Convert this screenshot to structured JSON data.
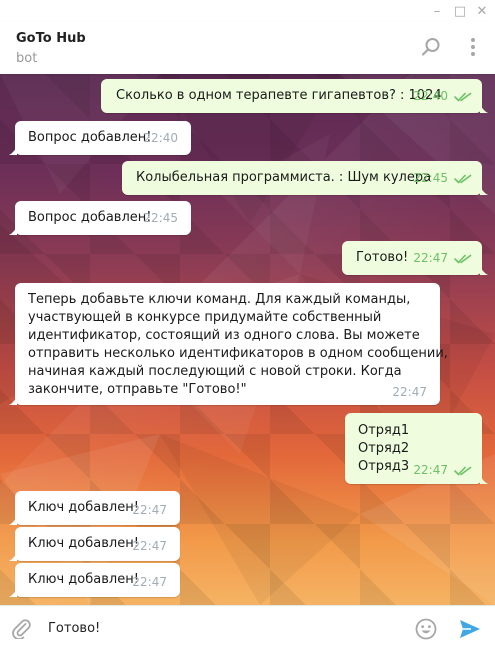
{
  "window": {
    "minimize": "–",
    "maximize": "□",
    "close": "✕"
  },
  "header": {
    "title": "GoTo Hub",
    "subtitle": "bot"
  },
  "messages": [
    {
      "dir": "out",
      "text": "Сколько в одном терапевте гигапевтов? : 1024",
      "time": "22:40"
    },
    {
      "dir": "in",
      "text": "Вопрос добавлен!",
      "time": "22:40"
    },
    {
      "dir": "out",
      "text": "Колыбельная программиста. : Шум кулера",
      "time": "22:45"
    },
    {
      "dir": "in",
      "text": "Вопрос добавлен!",
      "time": "22:45"
    },
    {
      "dir": "out",
      "text": "Готово!",
      "time": "22:47"
    },
    {
      "dir": "in",
      "text": "Теперь добавьте ключи команд. Для каждый команды,\nучаствующей в конкурсе придумайте собственный\nидентификатор, состоящий из одного слова. Вы можете\nотправить несколько идентификаторов в одном сообщении,\nначиная каждый последующий с новой строки. Когда\nзакончите, отправьте \"Готово!\"",
      "time": "22:47"
    },
    {
      "dir": "out",
      "text": "Отряд1\nОтряд2\nОтряд3",
      "time": "22:47"
    },
    {
      "dir": "in",
      "text": "Ключ добавлен!",
      "time": "22:47"
    },
    {
      "dir": "in",
      "text": "Ключ добавлен!",
      "time": "22:47"
    },
    {
      "dir": "in",
      "text": "Ключ добавлен!",
      "time": "22:47"
    }
  ],
  "composer": {
    "value": "Готово!"
  },
  "icons": {
    "search": "search-icon",
    "more": "more-vertical-icon",
    "attach": "paperclip-icon",
    "emoji": "emoji-icon",
    "send": "send-icon",
    "read": "double-check-icon"
  },
  "colors": {
    "incoming_bubble": "#ffffff",
    "outgoing_bubble": "#effdde",
    "outgoing_time": "#6cc264",
    "incoming_time": "#a2acb4",
    "accent": "#40a7e3"
  }
}
